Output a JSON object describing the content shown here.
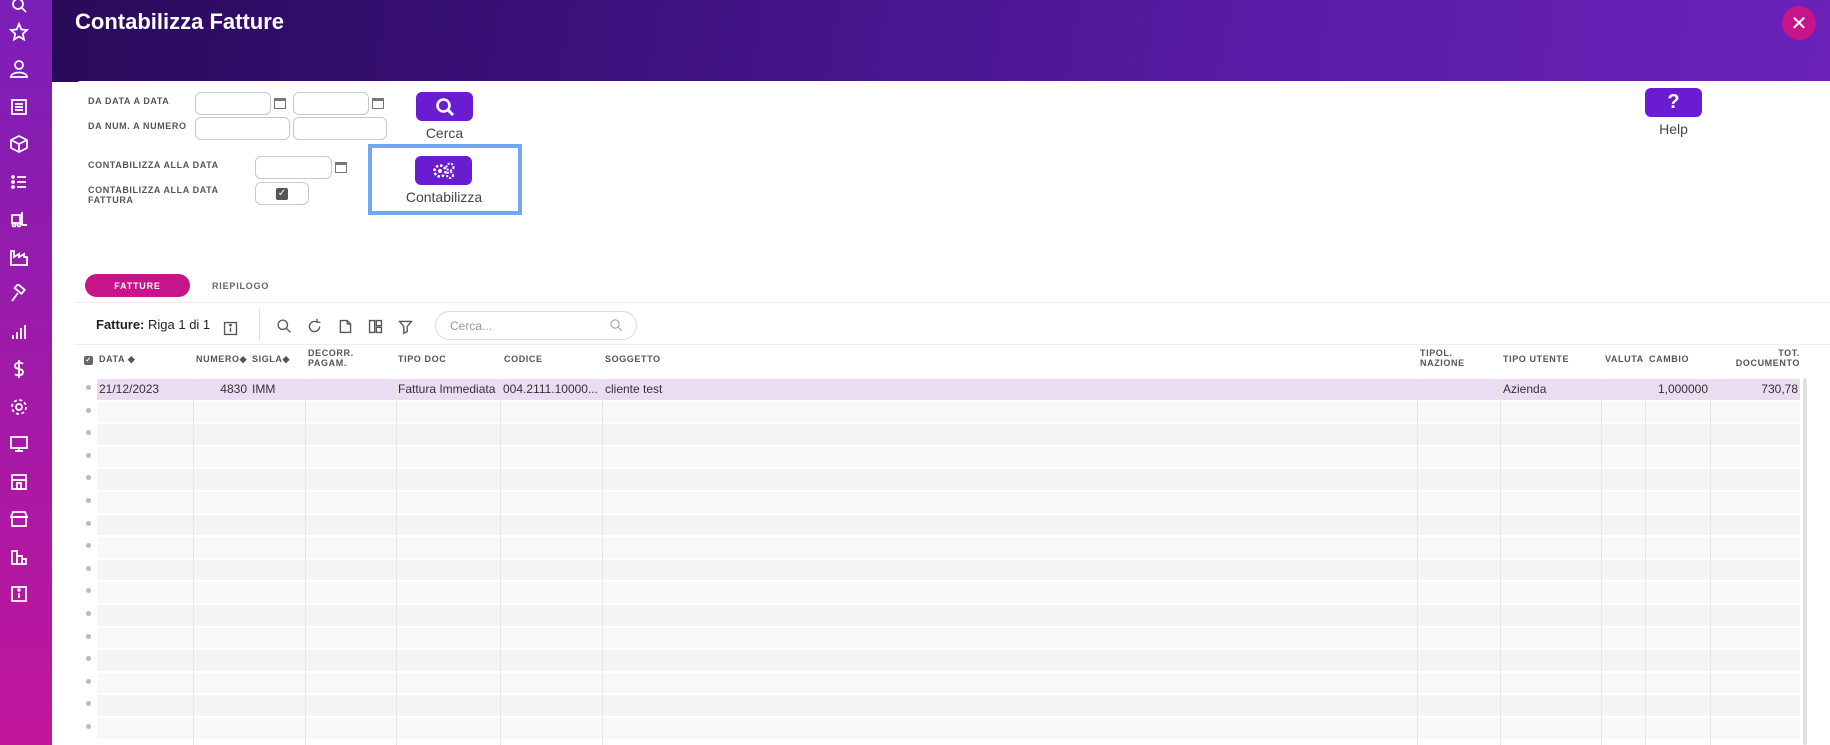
{
  "header": {
    "title": "Contabilizza Fatture",
    "close_icon": "close-icon"
  },
  "sidebar": {
    "icons": [
      "star-icon",
      "user-icon",
      "newspaper-icon",
      "box-icon",
      "list-icon",
      "forklift-icon",
      "factory-icon",
      "hammer-icon",
      "bar-chart-icon",
      "dollar-icon",
      "gear-icon",
      "monitor-icon",
      "store-icon",
      "shop-icon",
      "buildings-icon",
      "info-icon"
    ]
  },
  "filters": {
    "da_data_label": "DA DATA A DATA",
    "da_num_label": "DA NUM. A NUMERO",
    "contab_data_label": "CONTABILIZZA ALLA DATA",
    "contab_data_fattura_label_1": "CONTABILIZZA ALLA DATA",
    "contab_data_fattura_label_2": "FATTURA",
    "contab_data_fattura_checked": true
  },
  "actions": {
    "cerca": "Cerca",
    "contabilizza": "Contabilizza",
    "help": "Help"
  },
  "tabs": {
    "active": "FATTURE",
    "other": "RIEPILOGO"
  },
  "toolbar": {
    "title": "Fatture:",
    "counter": "Riga 1 di 1",
    "search_placeholder": "Cerca..."
  },
  "table": {
    "headers": {
      "data": "DATA",
      "numero": "NUMERO",
      "sigla": "SIGLA",
      "decorr_1": "DECORR.",
      "decorr_2": "PAGAM.",
      "tipo_doc": "TIPO DOC",
      "codice": "CODICE",
      "soggetto": "SOGGETTO",
      "tipol_1": "TIPOL.",
      "tipol_2": "NAZIONE",
      "tipo_utente": "TIPO UTENTE",
      "valuta": "VALUTA",
      "cambio": "CAMBIO",
      "tot_1": "TOT.",
      "tot_2": "DOCUMENTO"
    },
    "rows": [
      {
        "data": "21/12/2023",
        "numero": "4830",
        "sigla": "IMM",
        "decorr": "",
        "tipo_doc": "Fattura Immediata",
        "codice": "004.2111.10000...",
        "soggetto": "cliente test",
        "tipol": "",
        "tipo_utente": "Azienda",
        "valuta": "",
        "cambio": "1,000000",
        "tot": "730,78"
      }
    ]
  },
  "colors": {
    "accent": "#6a1cd0",
    "pink": "#c8148a",
    "highlight": "#6fa8f2"
  }
}
